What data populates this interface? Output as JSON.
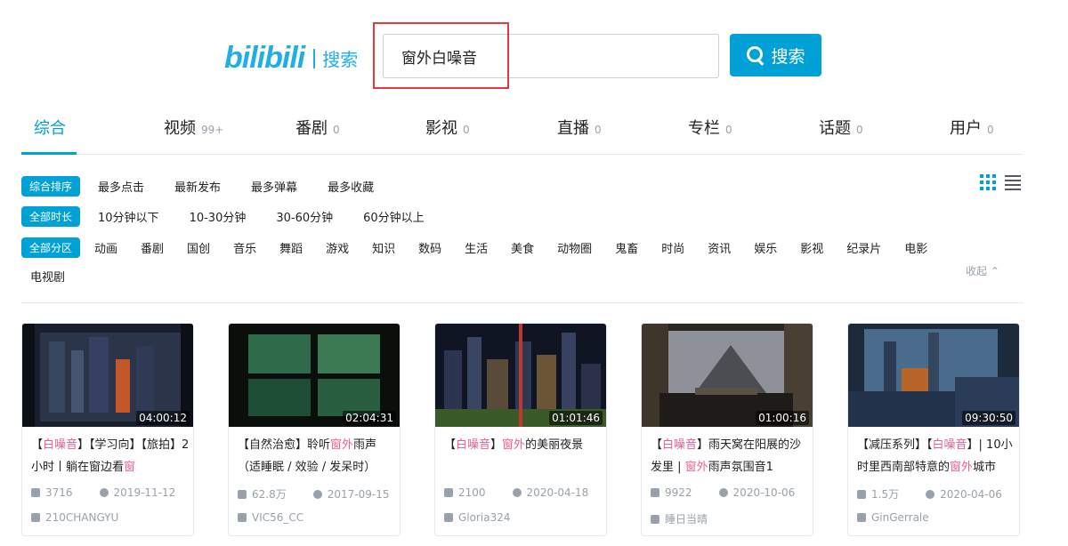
{
  "header": {
    "logo_text": "bilibili",
    "logo_sub": "搜索",
    "search_value": "窗外白噪音",
    "search_button": "搜索"
  },
  "tabs": [
    {
      "label": "综合",
      "count": ""
    },
    {
      "label": "视频",
      "count": "99+"
    },
    {
      "label": "番剧",
      "count": "0"
    },
    {
      "label": "影视",
      "count": "0"
    },
    {
      "label": "直播",
      "count": "0"
    },
    {
      "label": "专栏",
      "count": "0"
    },
    {
      "label": "话题",
      "count": "0"
    },
    {
      "label": "用户",
      "count": "0"
    }
  ],
  "filters": {
    "sort": {
      "active": "综合排序",
      "options": [
        "最多点击",
        "最新发布",
        "最多弹幕",
        "最多收藏"
      ]
    },
    "duration": {
      "active": "全部时长",
      "options": [
        "10分钟以下",
        "10-30分钟",
        "30-60分钟",
        "60分钟以上"
      ]
    },
    "zone": {
      "active": "全部分区",
      "options": [
        "动画",
        "番剧",
        "国创",
        "音乐",
        "舞蹈",
        "游戏",
        "知识",
        "数码",
        "生活",
        "美食",
        "动物圈",
        "鬼畜",
        "时尚",
        "资讯",
        "娱乐",
        "影视",
        "纪录片",
        "电影",
        "电视剧"
      ]
    },
    "collapse_label": "收起"
  },
  "videos": [
    {
      "duration": "04:00:12",
      "title_parts": [
        [
          "【",
          false
        ],
        [
          "白噪音",
          true
        ],
        [
          "】【学习向】【旅拍】2小时丨躺在窗边看",
          false
        ],
        [
          "窗",
          true
        ]
      ],
      "plays": "3716",
      "date": "2019-11-12",
      "author": "210CHANGYU"
    },
    {
      "duration": "02:04:31",
      "title_parts": [
        [
          "【自然治愈】聆听",
          false
        ],
        [
          "窗外",
          true
        ],
        [
          "雨声（适睡眠 / 效验 / 发呆时）",
          false
        ]
      ],
      "plays": "62.8万",
      "date": "2017-09-15",
      "author": "VIC56_CC"
    },
    {
      "duration": "01:01:46",
      "title_parts": [
        [
          "【",
          false
        ],
        [
          "白噪音",
          true
        ],
        [
          "】",
          false
        ],
        [
          "窗外",
          true
        ],
        [
          "的美丽夜景",
          false
        ]
      ],
      "plays": "2100",
      "date": "2020-04-18",
      "author": "Gloria324"
    },
    {
      "duration": "01:00:16",
      "title_parts": [
        [
          "【",
          false
        ],
        [
          "白噪音",
          true
        ],
        [
          "】雨天窝在阳展的沙发里 | ",
          false
        ],
        [
          "窗外",
          true
        ],
        [
          "雨声氛围音1",
          false
        ]
      ],
      "plays": "9922",
      "date": "2020-10-06",
      "author": "睡日当晴"
    },
    {
      "duration": "09:30:50",
      "title_parts": [
        [
          "【减压系列】【",
          false
        ],
        [
          "白噪音",
          true
        ],
        [
          "】| 10小时里西南部特意的",
          false
        ],
        [
          "窗外",
          true
        ],
        [
          "城市",
          false
        ]
      ],
      "plays": "1.5万",
      "date": "2020-04-06",
      "author": "GinGerrale"
    }
  ],
  "colors": {
    "accent": "#00a1d6",
    "highlight": "#f25d8e",
    "annotation_box": "#e5383b"
  }
}
